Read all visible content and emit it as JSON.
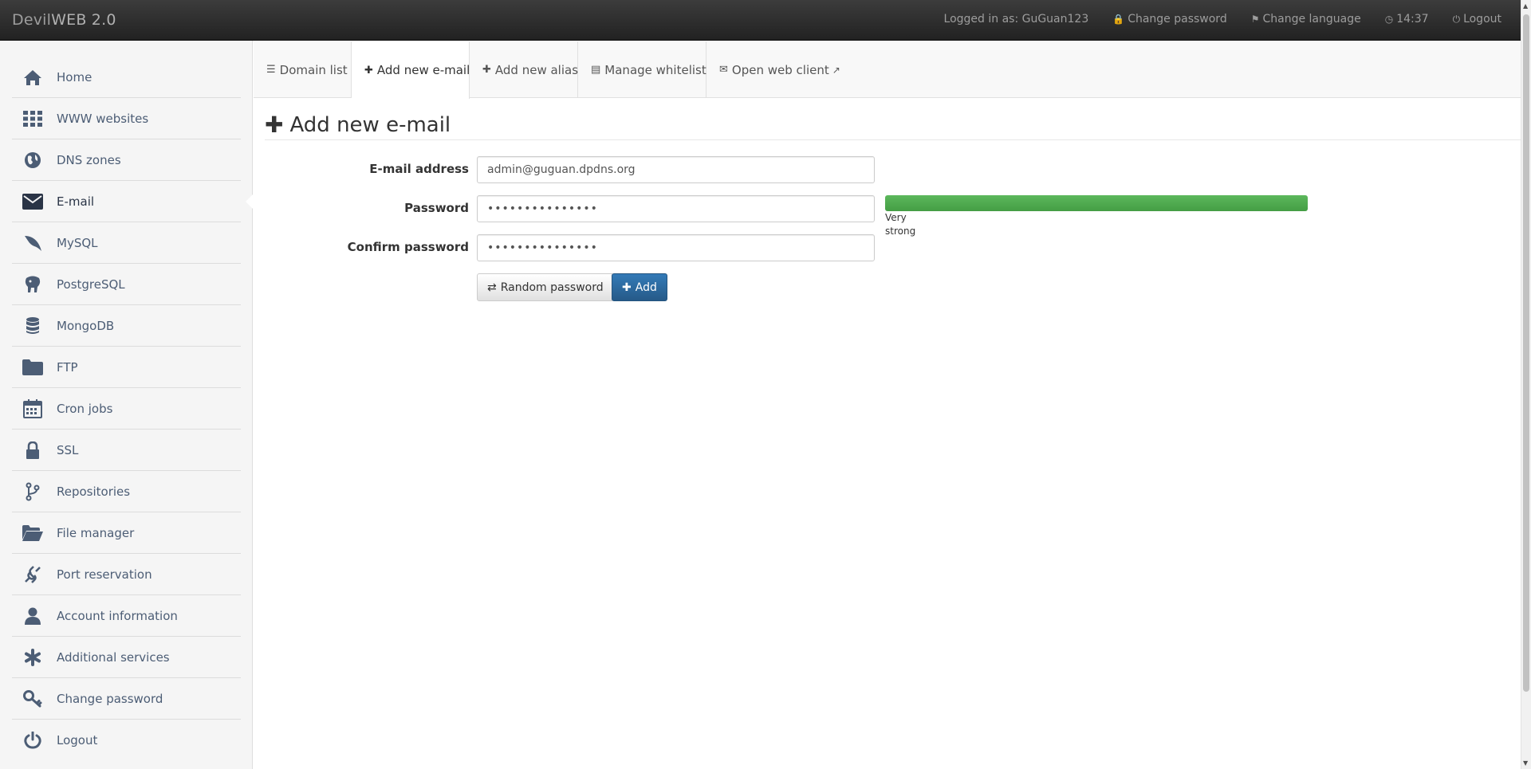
{
  "navbar": {
    "brand_prefix": "Devil",
    "brand_suffix": "WEB 2.0",
    "logged_in": "Logged in as: GuGuan123",
    "change_password": "Change password",
    "change_language": "Change language",
    "time": "14:37",
    "logout": "Logout"
  },
  "sidebar": {
    "items": [
      {
        "label": "Home",
        "icon": "home-icon"
      },
      {
        "label": "WWW websites",
        "icon": "grid-icon"
      },
      {
        "label": "DNS zones",
        "icon": "globe-icon"
      },
      {
        "label": "E-mail",
        "icon": "envelope-icon",
        "active": true
      },
      {
        "label": "MySQL",
        "icon": "dolphin-icon"
      },
      {
        "label": "PostgreSQL",
        "icon": "elephant-icon"
      },
      {
        "label": "MongoDB",
        "icon": "database-icon"
      },
      {
        "label": "FTP",
        "icon": "folder-icon"
      },
      {
        "label": "Cron jobs",
        "icon": "calendar-icon"
      },
      {
        "label": "SSL",
        "icon": "lock-icon"
      },
      {
        "label": "Repositories",
        "icon": "branch-icon"
      },
      {
        "label": "File manager",
        "icon": "folder-open-icon"
      },
      {
        "label": "Port reservation",
        "icon": "plug-icon"
      },
      {
        "label": "Account information",
        "icon": "user-icon"
      },
      {
        "label": "Additional services",
        "icon": "asterisk-icon"
      },
      {
        "label": "Change password",
        "icon": "key-icon"
      },
      {
        "label": "Logout",
        "icon": "power-icon"
      }
    ]
  },
  "tabs": {
    "domain_list": "Domain list",
    "add_new_email": "Add new e-mail",
    "add_new_alias": "Add new alias",
    "manage_whitelist": "Manage whitelist",
    "open_web_client": "Open web client"
  },
  "main": {
    "title": "Add new e-mail",
    "email_label": "E-mail address",
    "email_value": "admin@guguan.dpdns.org",
    "password_label": "Password",
    "password_value": "•••••••••••••••",
    "confirm_label": "Confirm password",
    "confirm_value": "•••••••••••••••",
    "strength_line1": "Very",
    "strength_line2": "strong",
    "strength_level": 1.0,
    "random_password": "Random password",
    "add": "Add"
  },
  "colors": {
    "strength_bar": "#5cb85c",
    "primary_button": "#337ab7",
    "sidebar_text": "#4c5d75"
  }
}
